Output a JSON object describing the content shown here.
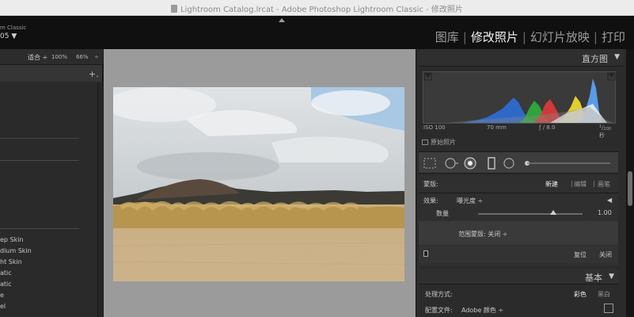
{
  "window": {
    "title": "Lightroom Catalog.lrcat - Adobe Photoshop Lightroom Classic - 修改照片"
  },
  "identity": {
    "line1": "m Classic",
    "line2": "05 ▼"
  },
  "modules": [
    {
      "label": "图库",
      "active": false
    },
    {
      "label": "修改照片",
      "active": true
    },
    {
      "label": "幻灯片放映",
      "active": false
    },
    {
      "label": "打印",
      "active": false
    }
  ],
  "navigator": {
    "fit": "适合 ÷",
    "zoom1": "100%",
    "zoom2": "66%",
    "arrows": "÷"
  },
  "presets": {
    "add": "+.",
    "items": [
      "ep Skin",
      "dium Skin",
      "ht Skin",
      "atic",
      "atic",
      "e",
      "el"
    ]
  },
  "histogram": {
    "title": "直方图",
    "iso": "ISO 100",
    "focal": "70 mm",
    "aperture": "ƒ / 8.0",
    "shutter_num": "1",
    "shutter_den": "200",
    "shutter_unit": "秒",
    "original_label": "原始照片"
  },
  "mask": {
    "label": "蒙版:",
    "new": "新建",
    "edit": "编辑",
    "brush": "画笔",
    "effect_label": "效果:",
    "effect_value": "曝光度 ÷",
    "amount_label": "数量",
    "amount_value": "1.00",
    "amount_level": 0.72,
    "range_label": "范围蒙版: 关闭 ÷",
    "reset": "复位",
    "close": "关闭"
  },
  "basic": {
    "title": "基本",
    "treatment_label": "处理方式:",
    "color": "彩色",
    "bw": "黑白",
    "profile_label": "配置文件:",
    "profile_value": "Adobe 颜色 ÷"
  }
}
